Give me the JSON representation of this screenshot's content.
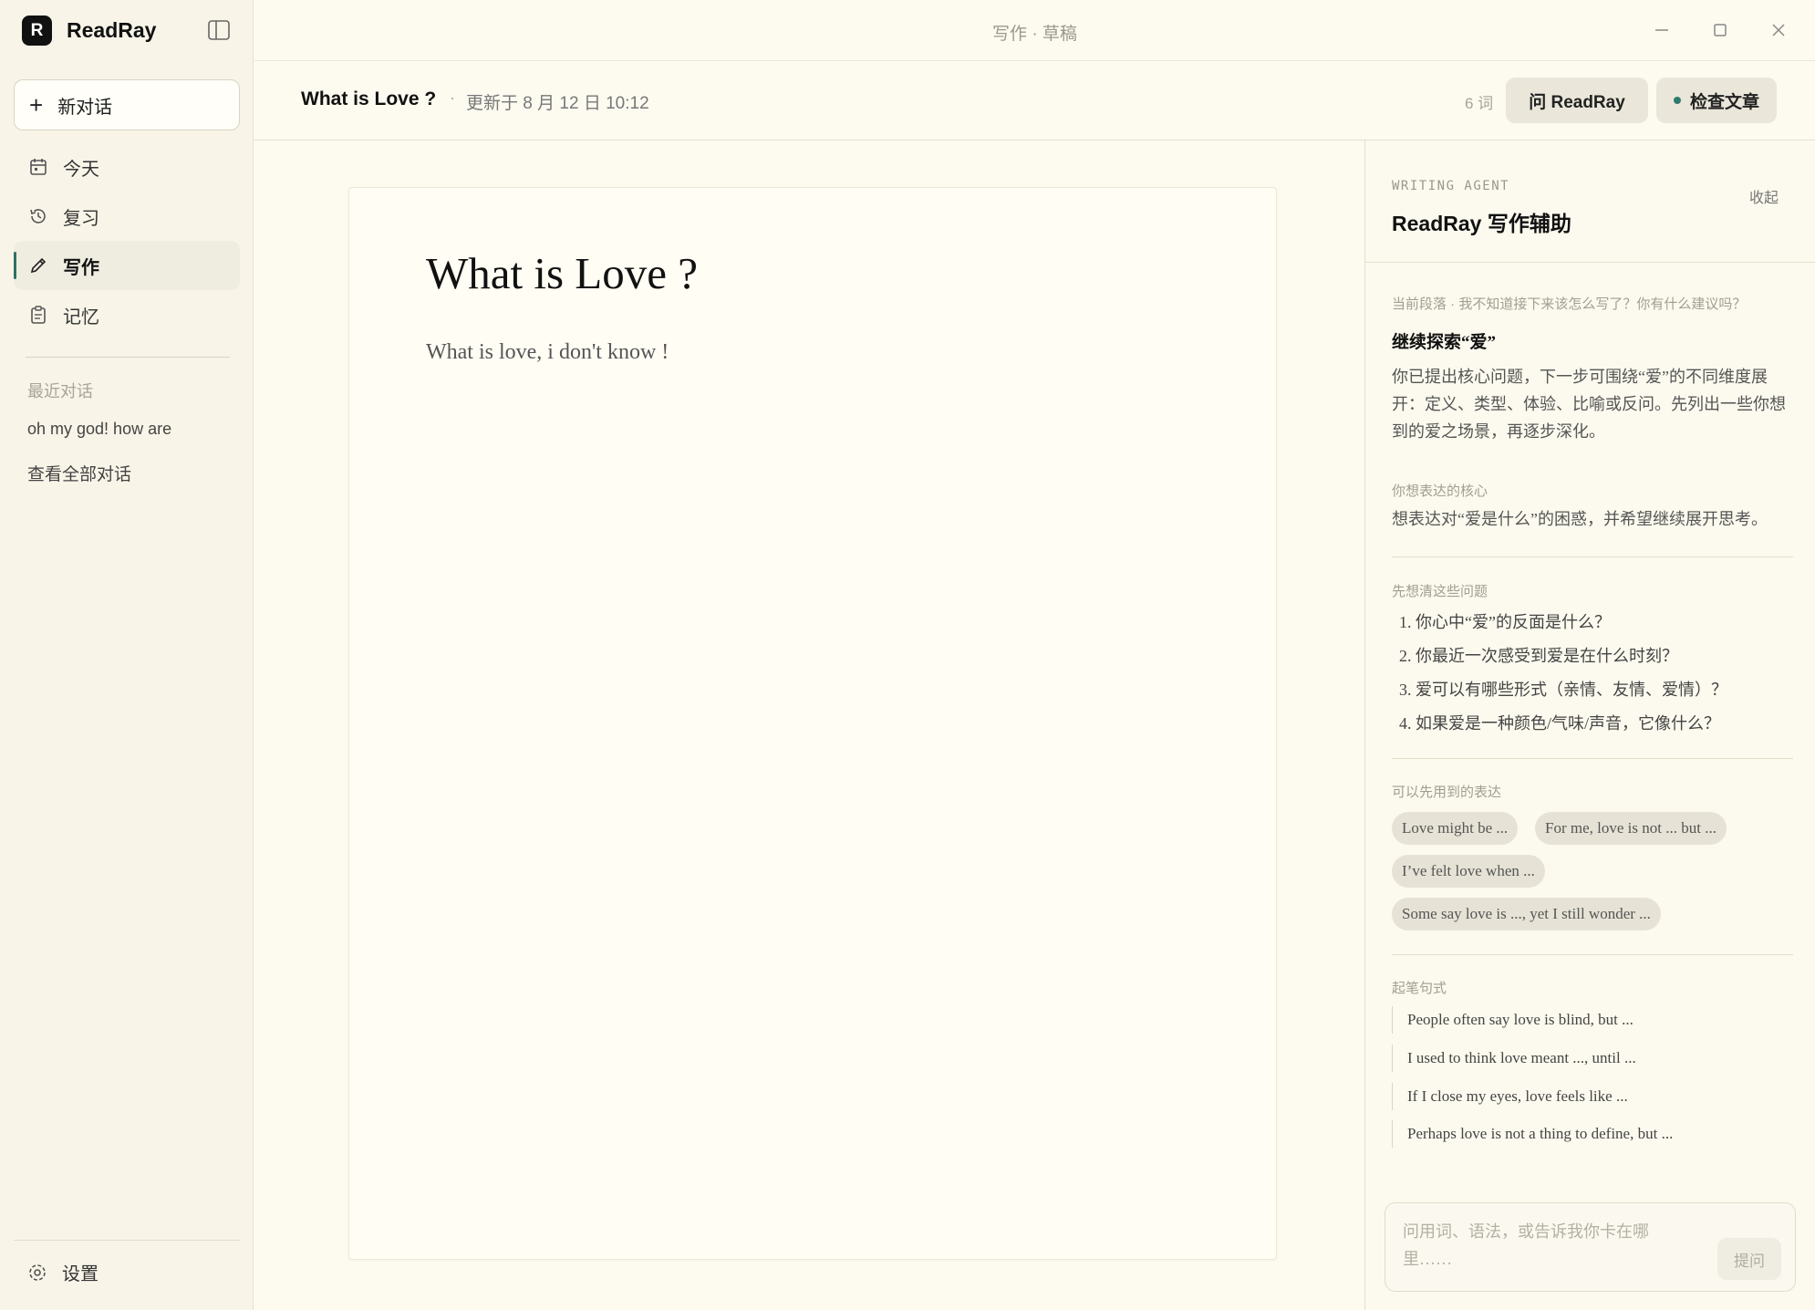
{
  "app": {
    "name": "ReadRay",
    "logo_letter": "R",
    "window_title": "写作 · 草稿"
  },
  "sidebar": {
    "new_chat_label": "新对话",
    "nav": [
      {
        "label": "今天",
        "icon": "calendar-icon",
        "active": false
      },
      {
        "label": "复习",
        "icon": "history-icon",
        "active": false
      },
      {
        "label": "写作",
        "icon": "pencil-icon",
        "active": true
      },
      {
        "label": "记忆",
        "icon": "clipboard-icon",
        "active": false
      }
    ],
    "recent_label": "最近对话",
    "recent_items": [
      "oh my god! how are"
    ],
    "view_all_label": "查看全部对话",
    "settings_label": "设置"
  },
  "doc_header": {
    "title": "What is Love ?",
    "separator": "·",
    "updated": "更新于 8 月 12 日 10:12",
    "word_count": "6 词",
    "ask_button": "问 ReadRay",
    "check_button": "检查文章"
  },
  "editor": {
    "title": "What is Love ?",
    "body": "What is love, i don't know !"
  },
  "panel": {
    "agent_label": "WRITING AGENT",
    "title": "ReadRay 写作辅助",
    "collapse_label": "收起",
    "context_label": "当前段落 · 我不知道接下来该怎么写了？你有什么建议吗？",
    "heading": "继续探索“爱”",
    "suggestion_lines": [
      "你已提出核心问题，下一步可围绕“爱”的不同维度展",
      "开：定义、类型、体验、比喻或反问。先列出一些你想",
      "到的爱之场景，再逐步深化。"
    ],
    "core_label": "你想表达的核心",
    "core_text": "想表达对“爱是什么”的困惑，并希望继续展开思考。",
    "questions_label": "先想清这些问题",
    "questions": [
      "1. 你心中“爱”的反面是什么？",
      "2. 你最近一次感受到爱是在什么时刻？",
      "3. 爱可以有哪些形式（亲情、友情、爱情）？",
      "4. 如果爱是一种颜色/气味/声音，它像什么？"
    ],
    "expressions_label": "可以先用到的表达",
    "expressions": [
      "Love might be ...",
      "For me, love is not ... but ...",
      "I’ve felt love when ...",
      "Some say love is ..., yet I still wonder ..."
    ],
    "starters_label": "起笔句式",
    "starters": [
      "People often say love is blind, but ...",
      "I used to think love meant ..., until ...",
      "If I close my eyes, love feels like ...",
      "Perhaps love is not a thing to define, but ..."
    ],
    "ask_placeholder": "问用词、语法，或告诉我你卡在哪里……",
    "ask_submit": "提问"
  },
  "colors": {
    "background": "#fdfbf0",
    "sidebar": "#f8f5e8",
    "accent": "#2f6f66"
  }
}
